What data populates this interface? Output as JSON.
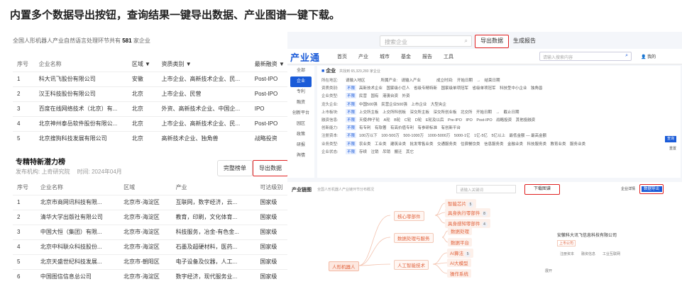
{
  "headline": "内置多个数据导出按钮，查询结果一键导出数据、产业图谱一键下载。",
  "left": {
    "summary_prefix": "全国人形机器人产业自然语言处理环节共有",
    "summary_count": "581",
    "summary_suffix": "家企业",
    "table1": {
      "headers": [
        "序号",
        "企业名称",
        "区域 ▼",
        "资质类别 ▼",
        "最新融资 ▼"
      ],
      "rows": [
        [
          "1",
          "科大讯飞股份有限公司",
          "安徽",
          "上市企业、高新技术企业、民...",
          "Post-IPO"
        ],
        [
          "2",
          "汉王科技股份有限公司",
          "北京",
          "上市企业、民营",
          "Post-IPO"
        ],
        [
          "3",
          "百度在线网络技术（北京）有...",
          "北京",
          "外资、高新技术企业、中国企...",
          "IPO"
        ],
        [
          "4",
          "北京神州泰岳软件股份有限公...",
          "北京",
          "上市企业、高新技术企业、民...",
          "Post-IPO"
        ],
        [
          "5",
          "北京搜狗科技发展有限公司",
          "北京",
          "高新技术企业、独角兽",
          "战略投资"
        ]
      ]
    },
    "section2": {
      "title": "专精特新潜力榜",
      "sub": "发布机构: 上奇研究院　 时间: 2024年04月",
      "full_list": "完整榜单",
      "export": "导出数据"
    },
    "table2": {
      "headers": [
        "序号",
        "企业名称",
        "区域",
        "产业",
        "可达级别"
      ],
      "rows": [
        [
          "1",
          "北京市商网讯科技有限...",
          "北京市-海淀区",
          "互联网，数字经济，云...",
          "国家级"
        ],
        [
          "2",
          "清华大学出版社有限公司",
          "北京市-海淀区",
          "教育，印刷，文化体育...",
          "国家级"
        ],
        [
          "3",
          "中国大恒（集团）有限...",
          "北京市-海淀区",
          "科技服务，冶金-有色金...",
          "国家级"
        ],
        [
          "4",
          "北京中科联众科技股份...",
          "北京市-海淀区",
          "石墨及超硬材料，医药...",
          "国家级"
        ],
        [
          "5",
          "北京天盛世纪科技发展...",
          "北京市-朝阳区",
          "电子设备及仪器，人工...",
          "国家级"
        ],
        [
          "6",
          "中国图信信息总公司",
          "北京市-海淀区",
          "数字经济，现代服务业...",
          "国家级"
        ]
      ]
    }
  },
  "right": {
    "top_search_placeholder": "搜索企业",
    "export_btn": "导出数据",
    "report_btn": "生成报告",
    "logo": "产业通",
    "nav": [
      "首页",
      "产业",
      "城市",
      "基金",
      "报告",
      "工具"
    ],
    "search_placeholder": "请输入搜索内容",
    "my": "我的",
    "side": [
      "全部",
      "企业",
      "专利",
      "融资",
      "创新平台",
      "园区",
      "政策",
      "研报",
      "舆情"
    ],
    "filter_title": "企业",
    "filter_count": "共找到 65,329,280 家企业",
    "filter_rows": [
      {
        "label": "所在地区:",
        "text": "请输入地区　　　　所属产业:　请输入产业　　　　成立时间:　开始日期　→　结束日期"
      },
      {
        "label": "资质类别:",
        "text": "高新技术企业　国家级小巨人　省级专精特新　国家级单项冠军　省级单项冠军　科技型中小企业　独角兽"
      },
      {
        "label": "企业类型:",
        "text": "民营　国有　港澳台资　外资"
      },
      {
        "label": "龙头企业:",
        "text": "中国500强　民营企业500强　上市企业　大型央企"
      },
      {
        "label": "上市板块:",
        "text": "上交所主板　上交所科创板　深交所主板　深交所创业板　北交所　开始日期　→　截止日期"
      },
      {
        "label": "融资信息:",
        "text": "天使/种子轮　A轮　B轮　C轮　D轮　E轮及以后　Pre-IPO　IPO　Post-IPO　战略投资　其他投融资"
      },
      {
        "label": "创新能力:",
        "text": "有专利　有软著　有高价值专利　有参研标准　有创新平台"
      },
      {
        "label": "注册资本:",
        "text": "100万以下　100-500万　500-1000万　1000-5000万　5000-1亿　1亿-5亿　5亿以上　最低金额 — 最高金额"
      },
      {
        "label": "业务类型:",
        "text": "农业类　工业类　建筑业类　批发零售业类　交通服务类　住宿餐饮类　信息服务类　金融业类　科技服务类　教育业类　服务业类"
      },
      {
        "label": "企业状态:",
        "text": "存续　注销　吊销　搬迁　其它"
      }
    ],
    "tag_unlimited": "不限",
    "query": "查询",
    "reset": "重置",
    "chain": {
      "title": "产业链图",
      "subtitle": "全国人形机器人产业链环节分布概况",
      "kw_placeholder": "请输入关键词",
      "download": "下载图谱",
      "ent_label": "企业详情",
      "export": "数据导出",
      "root": "人形机器人",
      "mids": [
        "核心零部件",
        "数据处理与服务",
        "人工智能技术"
      ],
      "leaves": [
        "智能芯片",
        "具身执行零部件",
        "具身感知零部件",
        "数据处理",
        "数据平台",
        "AI算法",
        "AI大模型",
        "操作系统"
      ],
      "counts": [
        "5",
        "8",
        "4",
        "5"
      ],
      "company": "安徽科大讯飞信息科技有限公司",
      "company_tag": "上市公司",
      "meta": "注册资本　　融资信息　　工业互联网",
      "expand": "展开"
    }
  }
}
